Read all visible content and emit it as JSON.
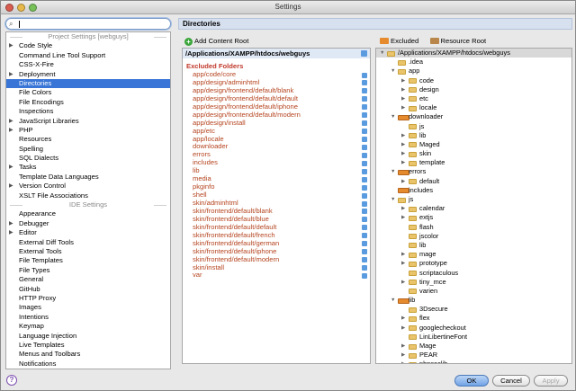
{
  "window": {
    "title": "Settings"
  },
  "search": {
    "value": ""
  },
  "left_tree": {
    "rows": [
      {
        "type": "section",
        "label": "Project Settings [webguys]"
      },
      {
        "type": "item",
        "label": "Code Style",
        "expandable": true
      },
      {
        "type": "item",
        "label": "Command Line Tool Support"
      },
      {
        "type": "item",
        "label": "CSS-X-Fire"
      },
      {
        "type": "item",
        "label": "Deployment",
        "expandable": true
      },
      {
        "type": "item",
        "label": "Directories",
        "selected": true
      },
      {
        "type": "item",
        "label": "File Colors"
      },
      {
        "type": "item",
        "label": "File Encodings"
      },
      {
        "type": "item",
        "label": "Inspections"
      },
      {
        "type": "item",
        "label": "JavaScript Libraries",
        "expandable": true
      },
      {
        "type": "item",
        "label": "PHP",
        "expandable": true
      },
      {
        "type": "item",
        "label": "Resources"
      },
      {
        "type": "item",
        "label": "Spelling"
      },
      {
        "type": "item",
        "label": "SQL Dialects"
      },
      {
        "type": "item",
        "label": "Tasks",
        "expandable": true
      },
      {
        "type": "item",
        "label": "Template Data Languages"
      },
      {
        "type": "item",
        "label": "Version Control",
        "expandable": true
      },
      {
        "type": "item",
        "label": "XSLT File Associations"
      },
      {
        "type": "section",
        "label": "IDE Settings"
      },
      {
        "type": "item",
        "label": "Appearance"
      },
      {
        "type": "item",
        "label": "Debugger",
        "expandable": true
      },
      {
        "type": "item",
        "label": "Editor",
        "expandable": true
      },
      {
        "type": "item",
        "label": "External Diff Tools"
      },
      {
        "type": "item",
        "label": "External Tools"
      },
      {
        "type": "item",
        "label": "File Templates"
      },
      {
        "type": "item",
        "label": "File Types"
      },
      {
        "type": "item",
        "label": "General"
      },
      {
        "type": "item",
        "label": "GitHub"
      },
      {
        "type": "item",
        "label": "HTTP Proxy"
      },
      {
        "type": "item",
        "label": "Images"
      },
      {
        "type": "item",
        "label": "Intentions"
      },
      {
        "type": "item",
        "label": "Keymap"
      },
      {
        "type": "item",
        "label": "Language Injection"
      },
      {
        "type": "item",
        "label": "Live Templates"
      },
      {
        "type": "item",
        "label": "Menus and Toolbars"
      },
      {
        "type": "item",
        "label": "Notifications"
      }
    ]
  },
  "panel": {
    "title": "Directories",
    "add_content_root": "Add Content Root",
    "excluded_label": "Excluded",
    "resource_root_label": "Resource Root"
  },
  "content_root": {
    "path": "/Applications/XAMPP/htdocs/webguys",
    "excluded_title": "Excluded Folders",
    "excluded": [
      "app/code/core",
      "app/design/adminhtml",
      "app/design/frontend/default/blank",
      "app/design/frontend/default/default",
      "app/design/frontend/default/iphone",
      "app/design/frontend/default/modern",
      "app/design/install",
      "app/etc",
      "app/locale",
      "downloader",
      "errors",
      "includes",
      "lib",
      "media",
      "pkginfo",
      "shell",
      "skin/adminhtml",
      "skin/frontend/default/blank",
      "skin/frontend/default/blue",
      "skin/frontend/default/default",
      "skin/frontend/default/french",
      "skin/frontend/default/german",
      "skin/frontend/default/iphone",
      "skin/frontend/default/modern",
      "skin/install",
      "var"
    ]
  },
  "dir_tree": [
    {
      "label": "/Applications/XAMPP/htdocs/webguys",
      "depth": 0,
      "arrow": "open",
      "kind": "plain",
      "selected": true
    },
    {
      "label": ".idea",
      "depth": 1,
      "arrow": "",
      "kind": "plain"
    },
    {
      "label": "app",
      "depth": 1,
      "arrow": "open",
      "kind": "plain"
    },
    {
      "label": "code",
      "depth": 2,
      "arrow": "closed",
      "kind": "plain"
    },
    {
      "label": "design",
      "depth": 2,
      "arrow": "closed",
      "kind": "plain"
    },
    {
      "label": "etc",
      "depth": 2,
      "arrow": "closed",
      "kind": "plain"
    },
    {
      "label": "locale",
      "depth": 2,
      "arrow": "closed",
      "kind": "plain"
    },
    {
      "label": "downloader",
      "depth": 1,
      "arrow": "open",
      "kind": "excl"
    },
    {
      "label": "js",
      "depth": 2,
      "arrow": "",
      "kind": "plain"
    },
    {
      "label": "lib",
      "depth": 2,
      "arrow": "closed",
      "kind": "plain"
    },
    {
      "label": "Maged",
      "depth": 2,
      "arrow": "closed",
      "kind": "plain"
    },
    {
      "label": "skin",
      "depth": 2,
      "arrow": "closed",
      "kind": "plain"
    },
    {
      "label": "template",
      "depth": 2,
      "arrow": "closed",
      "kind": "plain"
    },
    {
      "label": "errors",
      "depth": 1,
      "arrow": "open",
      "kind": "excl"
    },
    {
      "label": "default",
      "depth": 2,
      "arrow": "closed",
      "kind": "plain"
    },
    {
      "label": "includes",
      "depth": 1,
      "arrow": "",
      "kind": "excl"
    },
    {
      "label": "js",
      "depth": 1,
      "arrow": "open",
      "kind": "plain"
    },
    {
      "label": "calendar",
      "depth": 2,
      "arrow": "closed",
      "kind": "plain"
    },
    {
      "label": "extjs",
      "depth": 2,
      "arrow": "closed",
      "kind": "plain"
    },
    {
      "label": "flash",
      "depth": 2,
      "arrow": "",
      "kind": "plain"
    },
    {
      "label": "jscolor",
      "depth": 2,
      "arrow": "",
      "kind": "plain"
    },
    {
      "label": "lib",
      "depth": 2,
      "arrow": "",
      "kind": "plain"
    },
    {
      "label": "mage",
      "depth": 2,
      "arrow": "closed",
      "kind": "plain"
    },
    {
      "label": "prototype",
      "depth": 2,
      "arrow": "closed",
      "kind": "plain"
    },
    {
      "label": "scriptaculous",
      "depth": 2,
      "arrow": "",
      "kind": "plain"
    },
    {
      "label": "tiny_mce",
      "depth": 2,
      "arrow": "closed",
      "kind": "plain"
    },
    {
      "label": "varien",
      "depth": 2,
      "arrow": "",
      "kind": "plain"
    },
    {
      "label": "lib",
      "depth": 1,
      "arrow": "open",
      "kind": "excl"
    },
    {
      "label": "3Dsecure",
      "depth": 2,
      "arrow": "",
      "kind": "plain"
    },
    {
      "label": "flex",
      "depth": 2,
      "arrow": "closed",
      "kind": "plain"
    },
    {
      "label": "googlecheckout",
      "depth": 2,
      "arrow": "closed",
      "kind": "plain"
    },
    {
      "label": "LinLibertineFont",
      "depth": 2,
      "arrow": "",
      "kind": "plain"
    },
    {
      "label": "Mage",
      "depth": 2,
      "arrow": "closed",
      "kind": "plain"
    },
    {
      "label": "PEAR",
      "depth": 2,
      "arrow": "closed",
      "kind": "plain"
    },
    {
      "label": "phpseclib",
      "depth": 2,
      "arrow": "closed",
      "kind": "plain"
    }
  ],
  "footer": {
    "help": "?",
    "ok": "OK",
    "cancel": "Cancel",
    "apply": "Apply"
  }
}
